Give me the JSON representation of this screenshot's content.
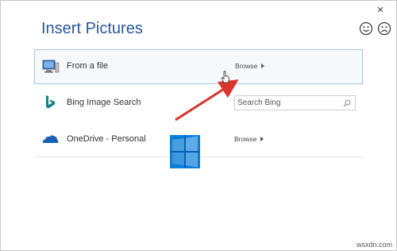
{
  "dialog": {
    "title": "Insert Pictures",
    "close_label": "×",
    "feedback": {
      "happy_icon": "smiley-happy-icon",
      "sad_icon": "smiley-sad-icon"
    }
  },
  "sources": [
    {
      "label": "From a file",
      "action_label": "Browse",
      "icon": "computer-icon"
    },
    {
      "label": "Bing Image Search",
      "search_placeholder": "Search Bing",
      "icon": "bing-logo-icon"
    },
    {
      "label": "OneDrive - Personal",
      "action_label": "Browse",
      "icon": "onedrive-cloud-icon"
    }
  ],
  "colors": {
    "title": "#2b579a",
    "selected_row_border": "#a9c4e6",
    "annotation_arrow": "#d9342b",
    "windows_logo": "#0a7fd9",
    "bing": "#0b8484"
  },
  "watermark": "wsxdn.com"
}
